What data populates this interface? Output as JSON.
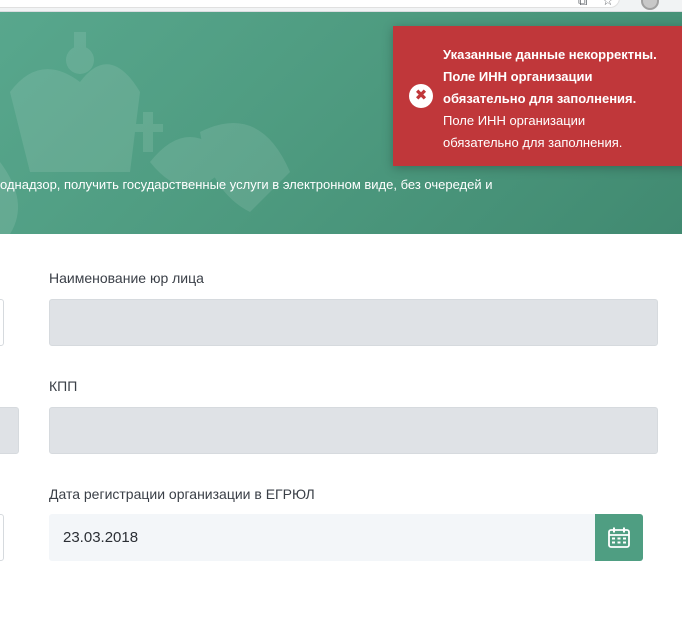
{
  "hero": {
    "tagline": "однадзор, получить государственные услуги в электронном виде, без очередей и"
  },
  "toast": {
    "icon": "error-x-icon",
    "color": "#c0373a",
    "title_lines": [
      "Указанные данные некорректны.",
      "Поле ИНН организации",
      "обязательно для заполнения."
    ],
    "body_lines": [
      "Поле ИНН организации",
      "обязательно для заполнения."
    ]
  },
  "form": {
    "name_label": "Наименование юр лица",
    "name_value": "",
    "kpp_label": "КПП",
    "kpp_value": "",
    "date_label": "Дата регистрации организации в ЕГРЮЛ",
    "date_value": "23.03.2018",
    "calendar_icon": "calendar-icon"
  },
  "colors": {
    "brand_green": "#4f9e82",
    "error_red": "#c0373a"
  }
}
